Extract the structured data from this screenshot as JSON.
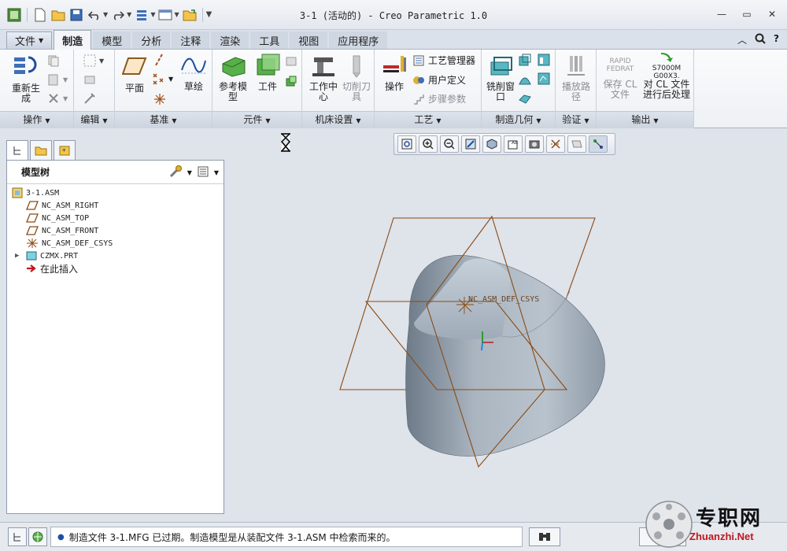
{
  "window": {
    "title": "3-1 (活动的) - Creo Parametric 1.0"
  },
  "tabs": [
    {
      "label": "文件"
    },
    {
      "label": "制造"
    },
    {
      "label": "模型"
    },
    {
      "label": "分析"
    },
    {
      "label": "注释"
    },
    {
      "label": "渲染"
    },
    {
      "label": "工具"
    },
    {
      "label": "视图"
    },
    {
      "label": "应用程序"
    }
  ],
  "ribbon": {
    "groups": {
      "operations": "操作",
      "edit": "编辑",
      "datum": "基准",
      "components": "元件",
      "machine_setup": "机床设置",
      "process": "工艺",
      "mfg_geometry": "制造几何",
      "verify": "验证",
      "output": "输出"
    },
    "regenerate": "重新生成",
    "plane": "平面",
    "sketch": "草绘",
    "ref_model": "参考模型",
    "workpiece": "工件",
    "work_center": "工作中心",
    "cutting_tool": "切削刀具",
    "operation": "操作",
    "process_manager": "工艺管理器",
    "user_defined": "用户定义",
    "step_params": "步骤参数",
    "mill_window": "铣削窗口",
    "play_path": "播放路径",
    "save_cl": "保存 CL 文件",
    "post_process": "对 CL 文件进行后处理",
    "rapid_icon_top": "RAPID",
    "rapid_icon_bottom": "FEDRAT",
    "post_icon_top": "S7000M",
    "post_icon_bottom": "G00X3."
  },
  "model_tree": {
    "title": "模型树",
    "items": [
      {
        "label": "3-1.ASM"
      },
      {
        "label": "NC_ASM_RIGHT"
      },
      {
        "label": "NC_ASM_TOP"
      },
      {
        "label": "NC_ASM_FRONT"
      },
      {
        "label": "NC_ASM_DEF_CSYS"
      },
      {
        "label": "CZMX.PRT"
      },
      {
        "label": "在此插入"
      }
    ]
  },
  "viewport": {
    "csys_label": "NC_ASM_DEF_CSYS"
  },
  "status": {
    "message": "制造文件 3-1.MFG 已过期。制造模型是从装配文件 3-1.ASM 中检索而来的。"
  },
  "watermark": {
    "cn": "专职网",
    "en": "Zhuanzhi.Net"
  }
}
